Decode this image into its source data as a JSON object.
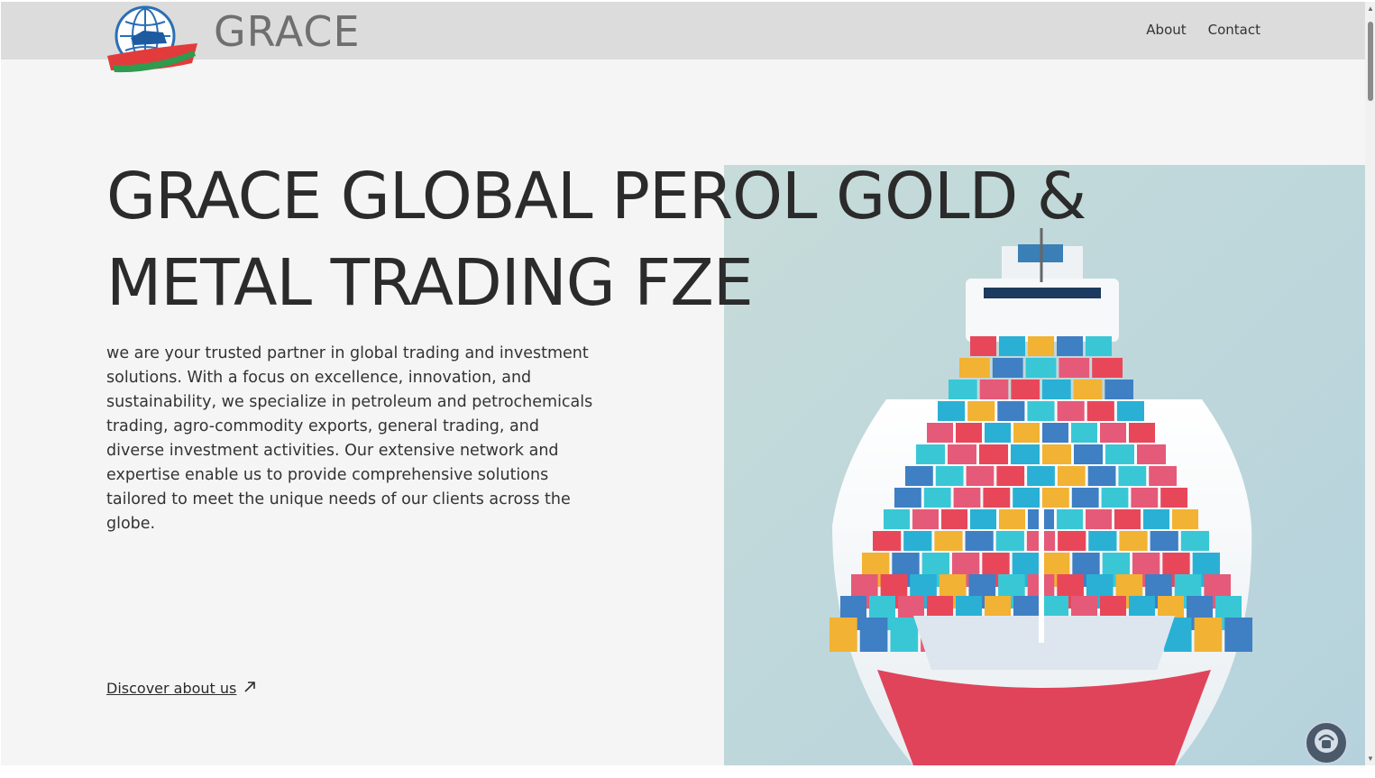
{
  "header": {
    "brand": "GRACE",
    "nav": [
      {
        "label": "About"
      },
      {
        "label": "Contact"
      }
    ]
  },
  "hero": {
    "title_line1": "GRACE GLOBAL PEROL GOLD &",
    "title_line2": "METAL TRADING FZE",
    "description": "we are your trusted partner in global trading and investment solutions. With a focus on excellence, innovation, and sustainability, we specialize in petroleum and petrochemicals trading, agro-commodity exports, general trading, and diverse investment activities. Our extensive network and expertise enable us to provide comprehensive solutions tailored to meet the unique needs of our clients across the globe.",
    "cta_label": "Discover about us",
    "cta_icon": "arrow-up-right-icon",
    "image_subject": "container ship loaded with colorful shipping containers"
  },
  "widgets": {
    "chat_icon": "support-chat-icon"
  },
  "colors": {
    "header_bg": "#dcdcdc",
    "page_bg": "#f5f5f5",
    "text": "#2b2b2b",
    "brand_text": "#6f6f6f"
  }
}
